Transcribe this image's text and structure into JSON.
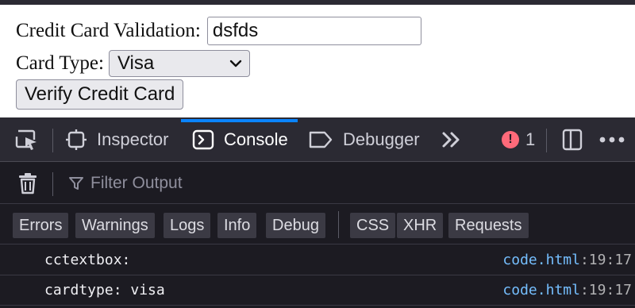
{
  "page": {
    "cc_label": "Credit Card Validation:",
    "cc_value": "dsfds",
    "type_label": "Card Type:",
    "type_selected": "Visa",
    "verify_button": "Verify Credit Card"
  },
  "devtools": {
    "tabs": [
      {
        "label": "Inspector",
        "icon": "inspector-icon"
      },
      {
        "label": "Console",
        "icon": "console-icon",
        "active": true
      },
      {
        "label": "Debugger",
        "icon": "debugger-icon"
      }
    ],
    "error_count": "1",
    "filter_placeholder": "Filter Output",
    "categories": [
      "Errors",
      "Warnings",
      "Logs",
      "Info",
      "Debug",
      "CSS",
      "XHR",
      "Requests"
    ],
    "messages": [
      {
        "text": "cctextbox:",
        "file": "code.html",
        "line": ":19:17"
      },
      {
        "text": "cardtype: visa",
        "file": "code.html",
        "line": ":19:17"
      }
    ],
    "colors": {
      "active_tab": "#0a84ff",
      "error_badge": "#ff6a7a",
      "link": "#75bfff"
    }
  }
}
